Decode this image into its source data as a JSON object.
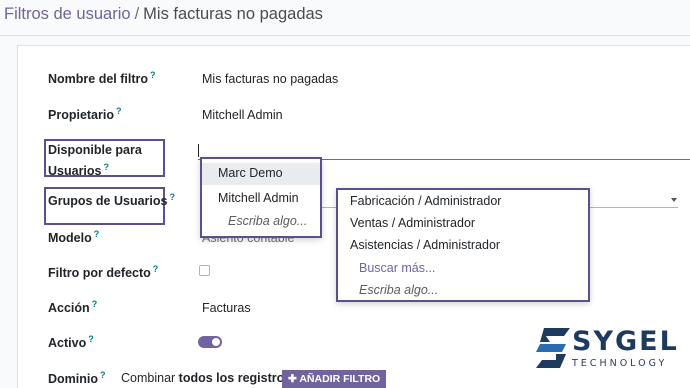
{
  "breadcrumb": {
    "parent": "Filtros de usuario",
    "separator": "/",
    "current": "Mis facturas no pagadas"
  },
  "form": {
    "fields": {
      "nombre": {
        "label": "Nombre del filtro",
        "help": "?",
        "value": "Mis facturas no pagadas"
      },
      "propietario": {
        "label": "Propietario",
        "help": "?",
        "value": "Mitchell Admin"
      },
      "disponible": {
        "label_line1": "Disponible para",
        "label_line2": "Usuarios",
        "help": "?",
        "value": ""
      },
      "grupos": {
        "label": "Grupos de Usuarios",
        "help": "?"
      },
      "modelo": {
        "label": "Modelo",
        "help": "?",
        "value": "Asiento contable"
      },
      "filtro_defecto": {
        "label": "Filtro por defecto",
        "help": "?",
        "checked": false
      },
      "accion": {
        "label": "Acción",
        "help": "?",
        "value": "Facturas"
      },
      "activo": {
        "label": "Activo",
        "help": "?",
        "on": true
      },
      "dominio": {
        "label": "Dominio",
        "help": "?",
        "text_before": "Combinar",
        "text_bold": "todos los registros",
        "add_filter_label": "✚ AÑADIR FILTRO"
      }
    }
  },
  "users_dropdown": {
    "items": [
      "Marc Demo",
      "Mitchell Admin"
    ],
    "create_label": "Escriba algo..."
  },
  "groups_dropdown": {
    "items": [
      "Fabricación / Administrador",
      "Ventas / Administrador",
      "Asistencias / Administrador"
    ],
    "search_more_label": "Buscar más...",
    "create_label": "Escriba algo..."
  },
  "logo": {
    "name": "SYGEL",
    "subtitle": "TECHNOLOGY"
  },
  "colors": {
    "accent": "#71639e",
    "highlight_border": "#5c5088",
    "logo": "#1f3a5f",
    "help_icon": "#017e84"
  }
}
